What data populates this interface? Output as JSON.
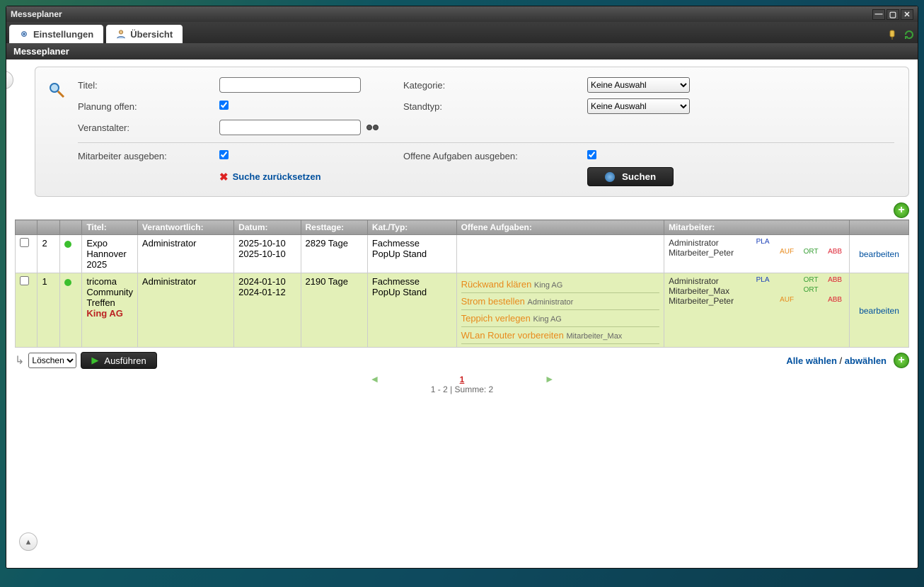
{
  "window": {
    "title": "Messeplaner"
  },
  "tabs": {
    "settings": "Einstellungen",
    "overview": "Übersicht"
  },
  "subheader": "Messeplaner",
  "search": {
    "title_label": "Titel:",
    "planning_open_label": "Planung offen:",
    "organizer_label": "Veranstalter:",
    "category_label": "Kategorie:",
    "standtype_label": "Standtyp:",
    "no_selection": "Keine Auswahl",
    "employees_out_label": "Mitarbeiter ausgeben:",
    "open_tasks_out_label": "Offene Aufgaben ausgeben:",
    "reset_label": "Suche zurücksetzen",
    "search_button": "Suchen"
  },
  "columns": {
    "check": "",
    "id": "",
    "status": "",
    "title": "Titel:",
    "responsible": "Verantwortlich:",
    "date": "Datum:",
    "rest": "Resttage:",
    "cat": "Kat./Typ:",
    "tasks": "Offene Aufgaben:",
    "emp": "Mitarbeiter:",
    "edit": ""
  },
  "rows": [
    {
      "id": "2",
      "title_l1": "Expo",
      "title_l2": "Hannover",
      "title_l3": "2025",
      "responsible": "Administrator",
      "date_l1": "2025-10-10",
      "date_l2": "2025-10-10",
      "rest": "2829 Tage",
      "cat_l1": "Fachmesse",
      "cat_l2": "PopUp Stand",
      "tasks": [],
      "employees": [
        {
          "name": "Administrator",
          "pla": "PLA",
          "auf": "",
          "ort": "",
          "abb": ""
        },
        {
          "name": "Mitarbeiter_Peter",
          "pla": "",
          "auf": "AUF",
          "ort": "ORT",
          "abb": "ABB"
        }
      ],
      "highlight": false
    },
    {
      "id": "1",
      "title_l1": "tricoma",
      "title_l2": "Community",
      "title_l3": "Treffen",
      "title_king": "King AG",
      "responsible": "Administrator",
      "date_l1": "2024-01-10",
      "date_l2": "2024-01-12",
      "rest": "2190 Tage",
      "cat_l1": "Fachmesse",
      "cat_l2": "PopUp Stand",
      "tasks": [
        {
          "t": "Rückwand klären",
          "who": "King AG"
        },
        {
          "t": "Strom bestellen",
          "who": "Administrator"
        },
        {
          "t": "Teppich verlegen",
          "who": "King AG"
        },
        {
          "t": "WLan Router vorbereiten",
          "who": "Mitarbeiter_Max"
        }
      ],
      "employees": [
        {
          "name": "Administrator",
          "pla": "PLA",
          "auf": "",
          "ort": "ORT",
          "abb": "ABB"
        },
        {
          "name": "Mitarbeiter_Max",
          "pla": "",
          "auf": "",
          "ort": "ORT",
          "abb": ""
        },
        {
          "name": "Mitarbeiter_Peter",
          "pla": "",
          "auf": "AUF",
          "ort": "",
          "abb": "ABB"
        }
      ],
      "highlight": true
    }
  ],
  "edit_label": "bearbeiten",
  "footer": {
    "action_select": "Löschen",
    "exec": "Ausführen",
    "select_all": "Alle wählen",
    "deselect_all": "abwählen",
    "page": "1",
    "summary": "1 - 2 | Summe: 2"
  }
}
